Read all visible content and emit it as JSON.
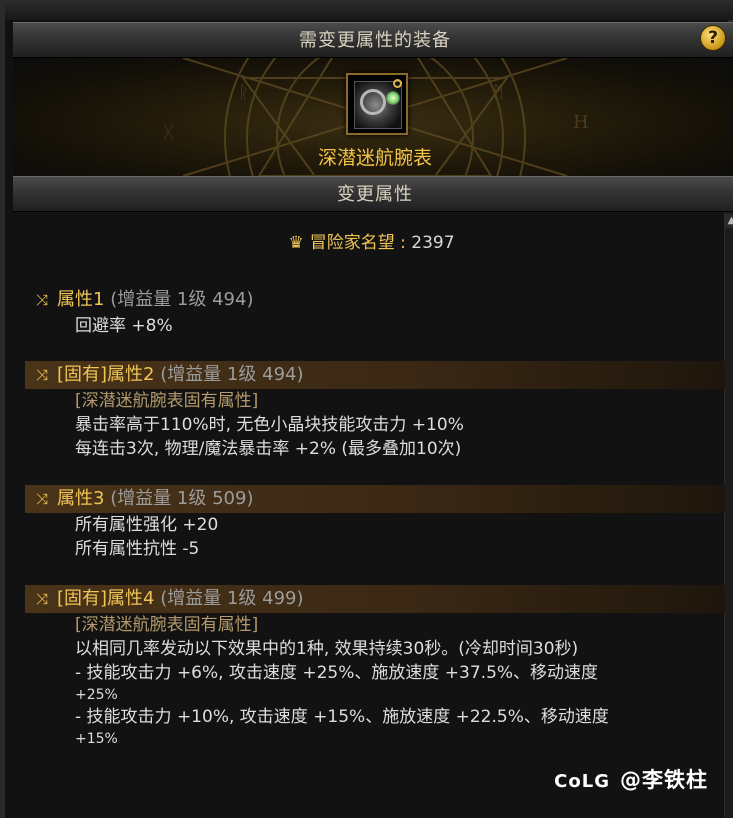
{
  "window": {
    "title": "需变更属性的装备",
    "help_label": "?",
    "section_title": "变更属性"
  },
  "item": {
    "name": "深潜迷航腕表",
    "icon": "watch-icon"
  },
  "fame": {
    "label": "冒险家名望 : ",
    "value": "2397",
    "icon": "fame-crown-icon"
  },
  "attributes": [
    {
      "title": "属性1",
      "gain": "(增益量 1级 494)",
      "highlighted": false,
      "lines": [
        "回避率 +8%"
      ]
    },
    {
      "title": "[固有]属性2",
      "gain": "(增益量 1级 494)",
      "highlighted": true,
      "lines": [
        "[深潜迷航腕表固有属性]",
        "暴击率高于110%时, 无色小晶块技能攻击力 +10%",
        "每连击3次, 物理/魔法暴击率 +2% (最多叠加10次)"
      ]
    },
    {
      "title": "属性3",
      "gain": "(增益量 1级 509)",
      "highlighted": true,
      "lines": [
        "所有属性强化 +20",
        "所有属性抗性 -5"
      ]
    },
    {
      "title": "[固有]属性4",
      "gain": "(增益量 1级 499)",
      "highlighted": true,
      "lines": [
        "[深潜迷航腕表固有属性]",
        "以相同几率发动以下效果中的1种, 效果持续30秒。(冷却时间30秒)",
        "- 技能攻击力 +6%, 攻击速度 +25%、施放速度 +37.5%、移动速度",
        "+25%",
        "- 技能攻击力 +10%, 攻击速度 +15%、施放速度 +22.5%、移动速度",
        "+15%"
      ]
    }
  ],
  "watermark": {
    "logo": "CoLG",
    "user": "@李铁柱"
  },
  "colors": {
    "gold": "#f0c455",
    "text": "#dddddd",
    "sub": "#b49a6a"
  }
}
